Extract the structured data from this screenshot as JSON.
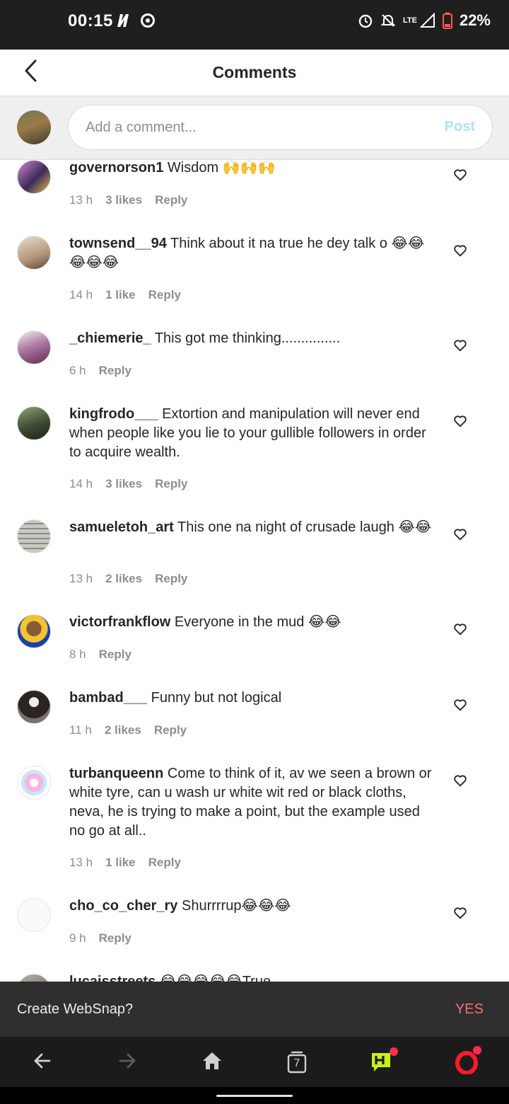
{
  "status_bar": {
    "time": "00:15",
    "network": "LTE",
    "battery": "22%"
  },
  "header": {
    "title": "Comments"
  },
  "composer": {
    "placeholder": "Add a comment...",
    "post_label": "Post"
  },
  "comments": [
    {
      "user": "governorson1",
      "text": "Wisdom 🙌🙌🙌",
      "time": "13 h",
      "likes": "3 likes",
      "reply": "Reply",
      "avatar_color": "#9b6aa8"
    },
    {
      "user": "townsend__94",
      "text": "Think about it na true he dey talk o 😂😂😂😂😂",
      "time": "14 h",
      "likes": "1 like",
      "reply": "Reply",
      "avatar_color": "#d9cfc3"
    },
    {
      "user": "_chiemerie_",
      "text": "This got me thinking...............",
      "time": "6 h",
      "likes": "",
      "reply": "Reply",
      "avatar_color": "#7a3f6e"
    },
    {
      "user": "kingfrodo___",
      "text": "Extortion and manipulation will never end when people like you lie to your gullible followers in order to acquire wealth.",
      "time": "14 h",
      "likes": "3 likes",
      "reply": "Reply",
      "avatar_color": "#4f6a43"
    },
    {
      "user": "samueletoh_art",
      "text": "This one na night of crusade laugh 😂😂",
      "time": "13 h",
      "likes": "2 likes",
      "reply": "Reply",
      "avatar_color": "#b6b6b0"
    },
    {
      "user": "victorfrankflow",
      "text": "Everyone in the mud 😂😂",
      "time": "8 h",
      "likes": "",
      "reply": "Reply",
      "avatar_color": "#1e3fa8"
    },
    {
      "user": "bambad___",
      "text": "Funny but not logical",
      "time": "11 h",
      "likes": "2 likes",
      "reply": "Reply",
      "avatar_color": "#5b5650"
    },
    {
      "user": "turbanqueenn",
      "text": "Come to think of it, av we seen a brown or white tyre, can u wash ur white wit red or black cloths, neva, he is trying to make a point, but the example used no go at all..",
      "time": "13 h",
      "likes": "1 like",
      "reply": "Reply",
      "avatar_color": "#f3c9e6"
    },
    {
      "user": "cho_co_cher_ry",
      "text": "Shurrrrup😂😂😂",
      "time": "9 h",
      "likes": "",
      "reply": "Reply",
      "avatar_color": "#ffffff"
    },
    {
      "user": "lucaisstreets",
      "text": "😂😂😂😂😂True",
      "time": "",
      "likes": "",
      "reply": "",
      "avatar_color": "#8a8a8a"
    }
  ],
  "websnap": {
    "prompt": "Create WebSnap?",
    "yes_label": "YES"
  },
  "bottom_nav": {
    "tab_count": "7"
  },
  "colors": {
    "accent_post": "#b2dffc",
    "yes": "#ff6b73"
  }
}
